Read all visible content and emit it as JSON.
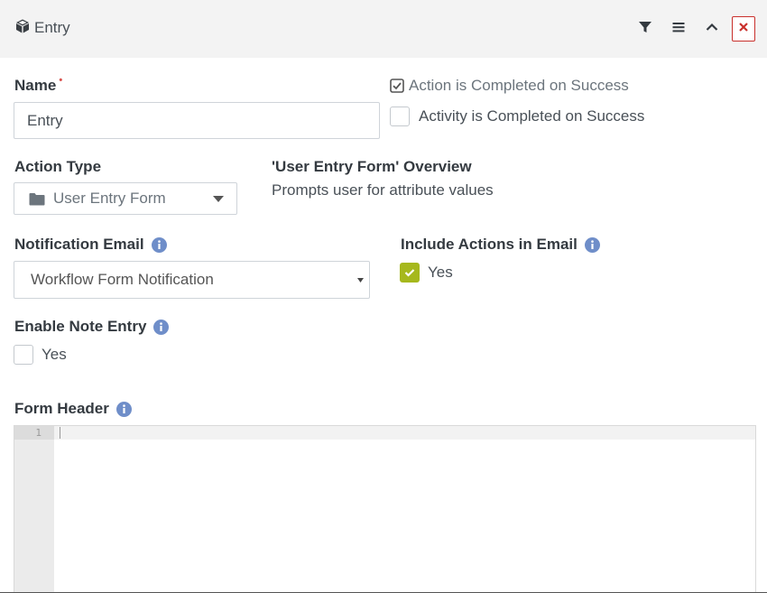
{
  "header": {
    "title": "Entry",
    "title_icon": "cube-icon",
    "actions": [
      "filter-icon",
      "menu-icon",
      "chevron-up-icon",
      "close-icon"
    ],
    "close_color": "#c9302c"
  },
  "name": {
    "label": "Name",
    "required_mark": "•",
    "value": "Entry"
  },
  "action_completed": {
    "label": "Action is Completed on Success",
    "checked": true
  },
  "activity_completed": {
    "label": "Activity is Completed on Success",
    "checked": false
  },
  "action_type": {
    "label": "Action Type",
    "selected": "User Entry Form",
    "icon": "folder-icon"
  },
  "overview": {
    "title": "'User Entry Form' Overview",
    "description": "Prompts user for attribute values"
  },
  "notification_email": {
    "label": "Notification Email",
    "selected": "Workflow Form Notification"
  },
  "include_actions": {
    "label": "Include Actions in Email",
    "option_label": "Yes",
    "checked": true,
    "accent_color": "#a6b81d"
  },
  "enable_note_entry": {
    "label": "Enable Note Entry",
    "option_label": "Yes",
    "checked": false
  },
  "form_header": {
    "label": "Form Header",
    "line_number": "1"
  },
  "colors": {
    "info_icon": "#6f8ec9",
    "header_bg": "#f3f3f3"
  }
}
